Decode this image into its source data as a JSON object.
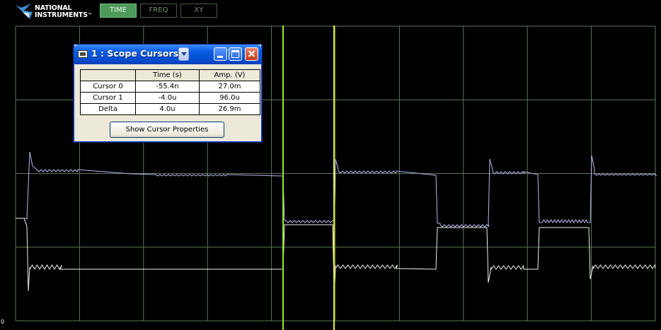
{
  "brand": {
    "line1": "NATIONAL",
    "line2": "INSTRUMENTS",
    "trademark": "™"
  },
  "mode_tabs": [
    {
      "label": "TIME",
      "active": true
    },
    {
      "label": "FREQ",
      "active": false
    },
    {
      "label": "XY",
      "active": false
    }
  ],
  "cursor_window": {
    "title": "1 : Scope Cursors",
    "columns": [
      "",
      "Time (s)",
      "Amp. (V)"
    ],
    "rows": [
      {
        "label": "Cursor 0",
        "time": "-55.4n",
        "amp": "27.0m"
      },
      {
        "label": "Cursor 1",
        "time": "-4.0u",
        "amp": "96.0u"
      },
      {
        "label": "Delta",
        "time": "4.0u",
        "amp": "26.9m"
      }
    ],
    "show_properties_label": "Show Cursor Properties"
  },
  "scope": {
    "zero_marker": "0",
    "colors": {
      "grid": "#5a7a5a",
      "channel_a": "#b8b8f0",
      "channel_b": "#f0f0f0",
      "cursor_0": "#9be62a",
      "cursor_1": "#e8f030"
    }
  }
}
